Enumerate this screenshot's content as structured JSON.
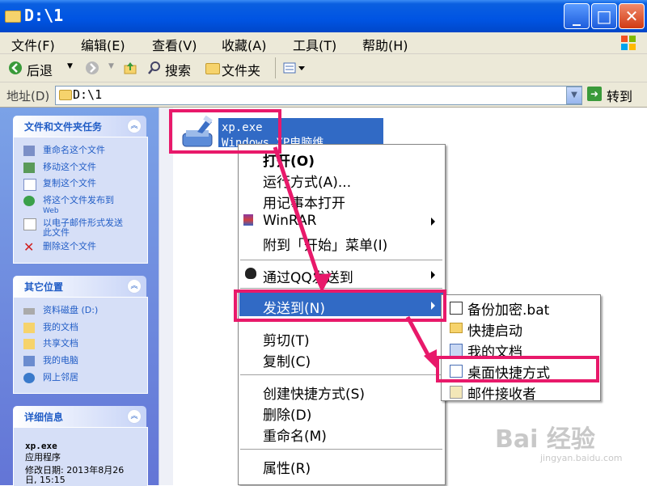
{
  "window": {
    "title": "D:\\1",
    "controls": {
      "minimize": "_",
      "maximize": "□",
      "close": "✕"
    }
  },
  "menubar": [
    "文件(F)",
    "编辑(E)",
    "查看(V)",
    "收藏(A)",
    "工具(T)",
    "帮助(H)"
  ],
  "toolbar": {
    "back": "后退",
    "search": "搜索",
    "folders": "文件夹"
  },
  "address": {
    "label": "地址(D)",
    "value": "D:\\1",
    "go": "转到"
  },
  "leftpane": {
    "tasks_title": "文件和文件夹任务",
    "tasks": [
      {
        "label": "重命名这个文件",
        "icon": "rename-icon"
      },
      {
        "label": "移动这个文件",
        "icon": "move-icon"
      },
      {
        "label": "复制这个文件",
        "icon": "copy-icon"
      },
      {
        "label": "将这个文件发布到",
        "label2": "Web",
        "icon": "web-publish-icon"
      },
      {
        "label": "以电子邮件形式发送",
        "label2": "此文件",
        "icon": "email-icon"
      },
      {
        "label": "删除这个文件",
        "icon": "delete-icon"
      }
    ],
    "places_title": "其它位置",
    "places": [
      {
        "label": "资料磁盘 (D:)",
        "icon": "drive-icon"
      },
      {
        "label": "我的文档",
        "icon": "my-documents-icon"
      },
      {
        "label": "共享文档",
        "icon": "shared-documents-icon"
      },
      {
        "label": "我的电脑",
        "icon": "my-computer-icon"
      },
      {
        "label": "网上邻居",
        "icon": "network-icon"
      }
    ],
    "details_title": "详细信息",
    "details_name": "xp.exe",
    "details_type": "应用程序",
    "details_modified": "修改日期: 2013年8月26",
    "details_modified2": "日, 15:15"
  },
  "file": {
    "name": "xp.exe",
    "description": "Windows XP电脑维"
  },
  "context_menu": {
    "open": "打开(O)",
    "run_as": "运行方式(A)...",
    "open_notepad": "用记事本打开",
    "winrar": "WinRAR",
    "pin_start": "附到「开始」菜单(I)",
    "send_qq": "通过QQ发送到",
    "send_to": "发送到(N)",
    "cut": "剪切(T)",
    "copy": "复制(C)",
    "create_shortcut": "创建快捷方式(S)",
    "delete": "删除(D)",
    "rename": "重命名(M)",
    "properties": "属性(R)"
  },
  "send_to_menu": [
    {
      "label": "备份加密.bat",
      "icon": "bat-file-icon"
    },
    {
      "label": "快捷启动",
      "icon": "folder-icon"
    },
    {
      "label": "我的文档",
      "icon": "my-documents-icon"
    },
    {
      "label": "桌面快捷方式",
      "icon": "desktop-icon"
    },
    {
      "label": "邮件接收者",
      "icon": "mail-recipient-icon"
    }
  ],
  "watermark": {
    "logo": "Bai 经验",
    "url": "jingyan.baidu.com"
  },
  "colors": {
    "highlight": "#e8196a",
    "selection": "#316ac5",
    "link": "#215dc6"
  }
}
